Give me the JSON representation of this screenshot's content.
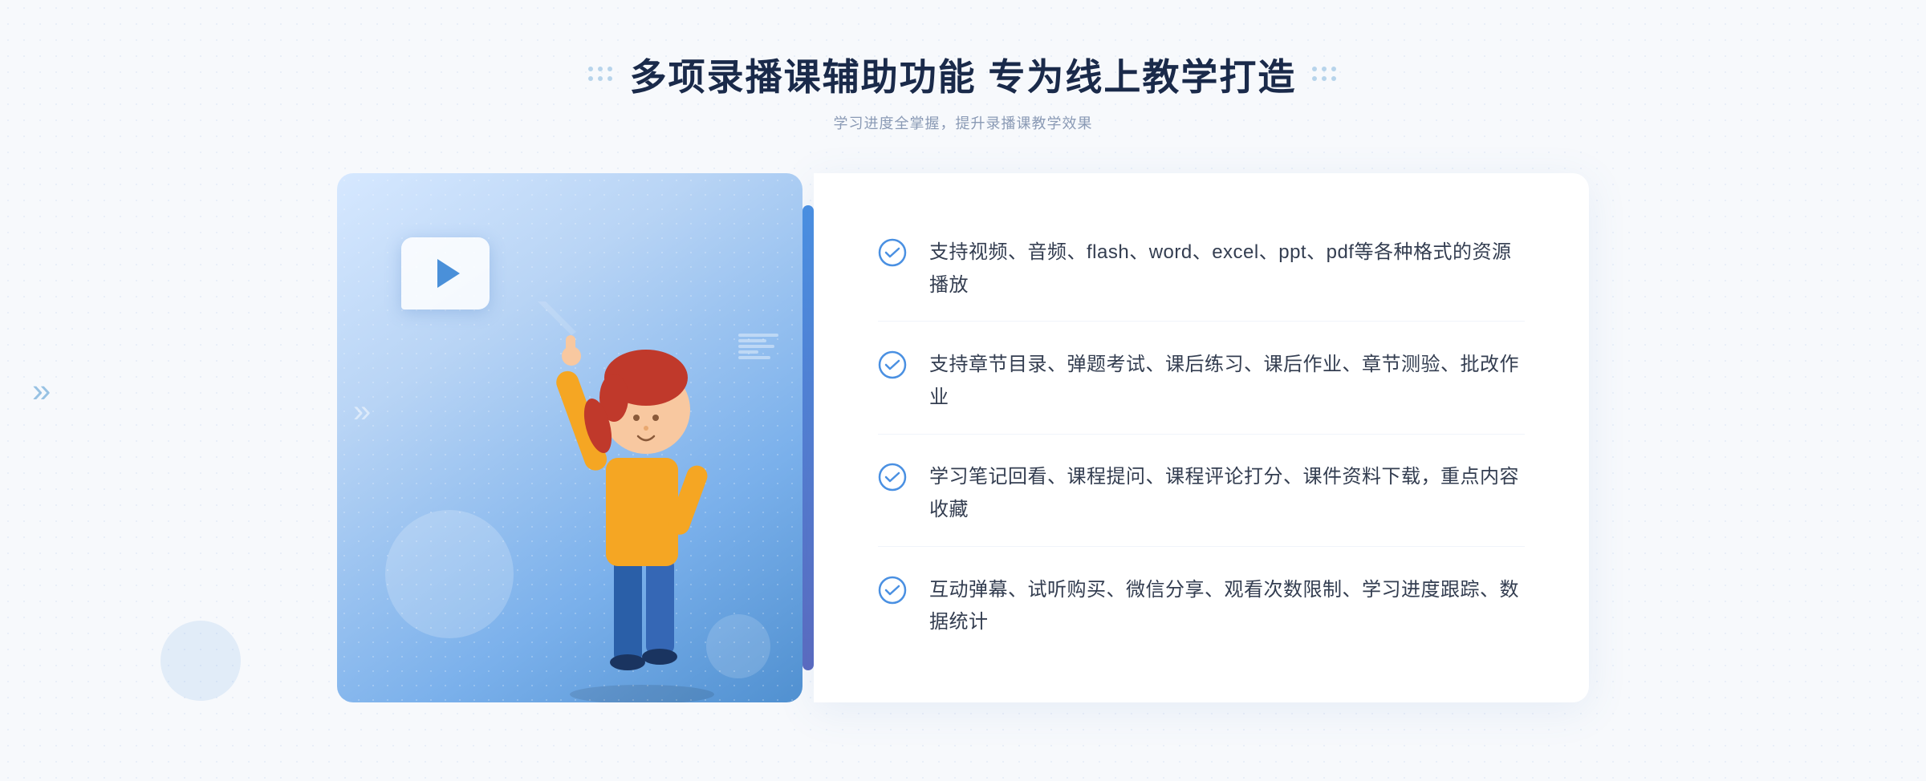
{
  "header": {
    "main_title": "多项录播课辅助功能 专为线上教学打造",
    "sub_title": "学习进度全掌握，提升录播课教学效果"
  },
  "features": [
    {
      "id": "feature-1",
      "text": "支持视频、音频、flash、word、excel、ppt、pdf等各种格式的资源播放"
    },
    {
      "id": "feature-2",
      "text": "支持章节目录、弹题考试、课后练习、课后作业、章节测验、批改作业"
    },
    {
      "id": "feature-3",
      "text": "学习笔记回看、课程提问、课程评论打分、课件资料下载，重点内容收藏"
    },
    {
      "id": "feature-4",
      "text": "互动弹幕、试听购买、微信分享、观看次数限制、学习进度跟踪、数据统计"
    }
  ],
  "colors": {
    "accent_blue": "#4a90e2",
    "title_dark": "#1a2a4a",
    "subtitle_gray": "#8a9ab5",
    "text_dark": "#333d50",
    "check_color": "#4a90e2"
  }
}
